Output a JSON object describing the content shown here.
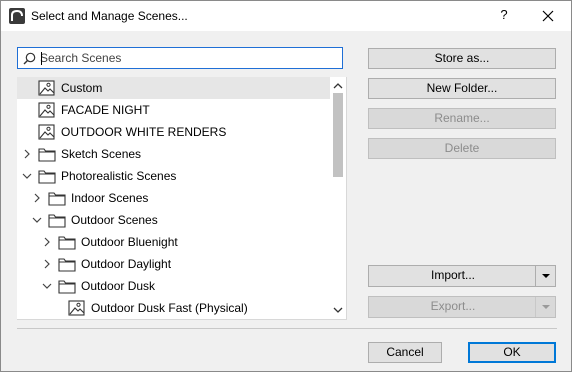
{
  "window": {
    "title": "Select and Manage Scenes...",
    "help": "?"
  },
  "search": {
    "placeholder": "Search Scenes"
  },
  "tree": {
    "items": [
      {
        "label": "Custom",
        "kind": "scene",
        "depth": 0,
        "selected": true
      },
      {
        "label": "FACADE NIGHT",
        "kind": "scene",
        "depth": 0
      },
      {
        "label": "OUTDOOR WHITE RENDERS",
        "kind": "scene",
        "depth": 0
      },
      {
        "label": "Sketch Scenes",
        "kind": "folder",
        "depth": 0,
        "expanded": false
      },
      {
        "label": "Photorealistic Scenes",
        "kind": "folder",
        "depth": 0,
        "expanded": true
      },
      {
        "label": "Indoor Scenes",
        "kind": "folder",
        "depth": 1,
        "expanded": false
      },
      {
        "label": "Outdoor Scenes",
        "kind": "folder",
        "depth": 1,
        "expanded": true
      },
      {
        "label": "Outdoor Bluenight",
        "kind": "folder",
        "depth": 2,
        "expanded": false
      },
      {
        "label": "Outdoor Daylight",
        "kind": "folder",
        "depth": 2,
        "expanded": false
      },
      {
        "label": "Outdoor Dusk",
        "kind": "folder",
        "depth": 2,
        "expanded": true
      },
      {
        "label": "Outdoor Dusk Fast (Physical)",
        "kind": "scene",
        "depth": 3
      }
    ]
  },
  "buttons": {
    "store_as": "Store as...",
    "new_folder": "New Folder...",
    "rename": "Rename...",
    "delete": "Delete",
    "import": "Import...",
    "export": "Export...",
    "cancel": "Cancel",
    "ok": "OK"
  },
  "colors": {
    "accent": "#0078d7",
    "selection": "#e6e6e6",
    "disabled_text": "#8c8c8c"
  }
}
